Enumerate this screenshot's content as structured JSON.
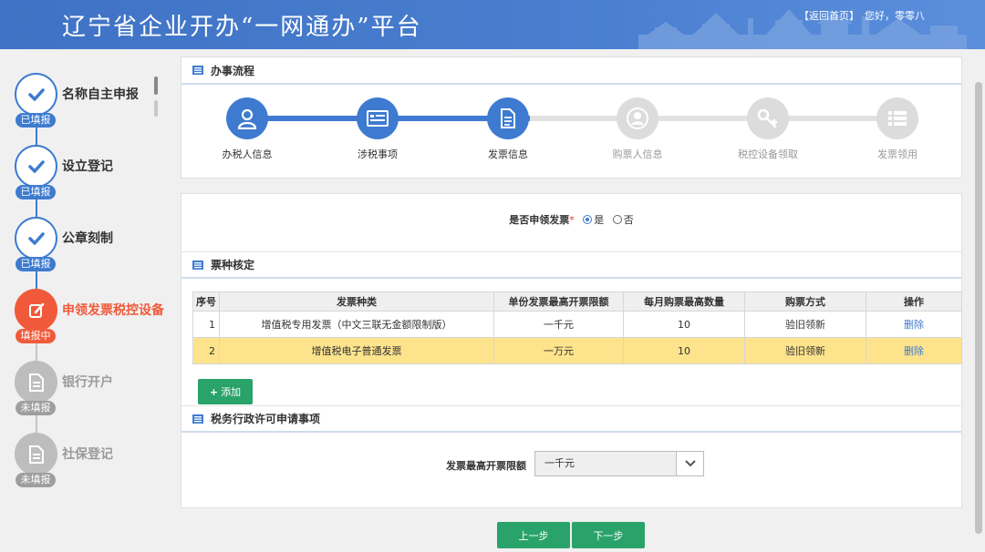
{
  "header": {
    "title": "辽宁省企业开办“一网通办”平台",
    "return_link": "【返回首页】",
    "greeting": "您好，零零八"
  },
  "sidebar": {
    "steps": [
      {
        "label": "名称自主申报",
        "status": "已填报",
        "state": "done",
        "icon": "check-icon"
      },
      {
        "label": "设立登记",
        "status": "已填报",
        "state": "done",
        "icon": "check-icon"
      },
      {
        "label": "公章刻制",
        "status": "已填报",
        "state": "done",
        "icon": "check-icon"
      },
      {
        "label": "申领发票税控设备",
        "status": "填报中",
        "state": "active",
        "icon": "edit-icon"
      },
      {
        "label": "银行开户",
        "status": "未填报",
        "state": "todo",
        "icon": "document-icon"
      },
      {
        "label": "社保登记",
        "status": "未填报",
        "state": "todo",
        "icon": "document-icon"
      }
    ]
  },
  "process": {
    "title": "办事流程",
    "steps": [
      {
        "label": "办税人信息",
        "state": "on",
        "icon": "user-icon"
      },
      {
        "label": "涉税事项",
        "state": "on",
        "icon": "card-icon"
      },
      {
        "label": "发票信息",
        "state": "on",
        "icon": "document-icon"
      },
      {
        "label": "购票人信息",
        "state": "off",
        "icon": "person-icon"
      },
      {
        "label": "税控设备领取",
        "state": "off",
        "icon": "key-icon"
      },
      {
        "label": "发票领用",
        "state": "off",
        "icon": "list-icon"
      }
    ]
  },
  "invoice_apply": {
    "label": "是否申领发票",
    "required_mark": "*",
    "option_yes": "是",
    "option_no": "否",
    "selected": "是"
  },
  "ticket_section": {
    "title": "票种核定",
    "columns": [
      "序号",
      "发票种类",
      "单份发票最高开票限额",
      "每月购票最高数量",
      "购票方式",
      "操作"
    ],
    "rows": [
      {
        "no": "1",
        "type": "增值税专用发票（中文三联无金额限制版）",
        "limit": "一千元",
        "qty": "10",
        "method": "验旧领新",
        "action": "删除"
      },
      {
        "no": "2",
        "type": "增值税电子普通发票",
        "limit": "一万元",
        "qty": "10",
        "method": "验旧领新",
        "action": "删除"
      }
    ],
    "add_button": "添加"
  },
  "permit_section": {
    "title": "税务行政许可申请事项",
    "field_label": "发票最高开票限额",
    "field_value": "一千元"
  },
  "footer": {
    "prev": "上一步",
    "next": "下一步"
  },
  "colors": {
    "primary": "#3e7bd0",
    "active": "#f05a3a",
    "green": "#29a36a",
    "highlight": "#fde38c"
  }
}
